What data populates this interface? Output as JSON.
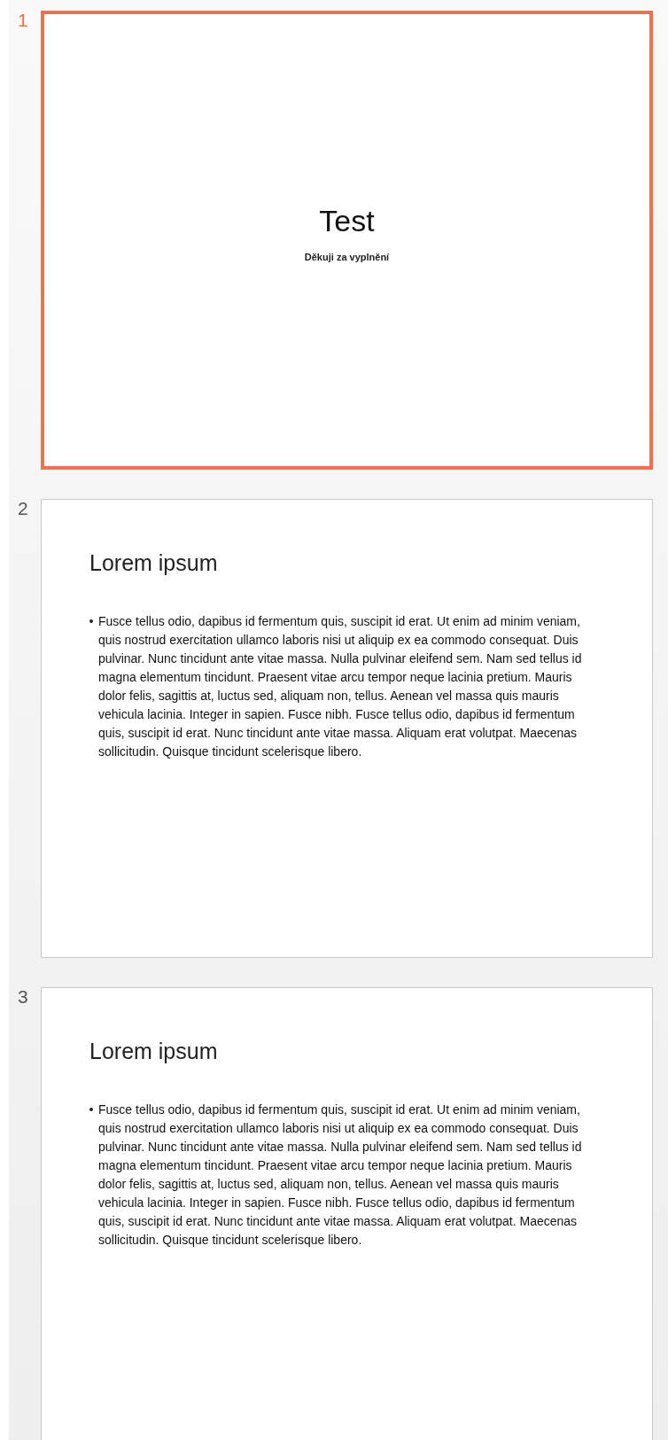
{
  "slides": [
    {
      "number": "1",
      "selected": true,
      "kind": "title",
      "title": "Test",
      "subtitle": "Děkuji za vyplnění"
    },
    {
      "number": "2",
      "selected": false,
      "kind": "content",
      "title": "Lorem ipsum",
      "bullets": [
        "Fusce tellus odio, dapibus id fermentum quis, suscipit id erat. Ut enim ad minim veniam, quis nostrud exercitation ullamco laboris nisi ut aliquip ex ea commodo consequat. Duis pulvinar. Nunc tincidunt ante vitae massa. Nulla pulvinar eleifend sem. Nam sed tellus id magna elementum tincidunt. Praesent vitae arcu tempor neque lacinia pretium. Mauris dolor felis, sagittis at, luctus sed, aliquam non, tellus. Aenean vel massa quis mauris vehicula lacinia. Integer in sapien. Fusce nibh. Fusce tellus odio, dapibus id fermentum quis, suscipit id erat. Nunc tincidunt ante vitae massa. Aliquam erat volutpat. Maecenas sollicitudin. Quisque tincidunt scelerisque libero."
      ]
    },
    {
      "number": "3",
      "selected": false,
      "kind": "content",
      "title": "Lorem ipsum",
      "bullets": [
        "Fusce tellus odio, dapibus id fermentum quis, suscipit id erat. Ut enim ad minim veniam, quis nostrud exercitation ullamco laboris nisi ut aliquip ex ea commodo consequat. Duis pulvinar. Nunc tincidunt ante vitae massa. Nulla pulvinar eleifend sem. Nam sed tellus id magna elementum tincidunt. Praesent vitae arcu tempor neque lacinia pretium. Mauris dolor felis, sagittis at, luctus sed, aliquam non, tellus. Aenean vel massa quis mauris vehicula lacinia. Integer in sapien. Fusce nibh. Fusce tellus odio, dapibus id fermentum quis, suscipit id erat. Nunc tincidunt ante vitae massa. Aliquam erat volutpat. Maecenas sollicitudin. Quisque tincidunt scelerisque libero."
      ]
    }
  ]
}
